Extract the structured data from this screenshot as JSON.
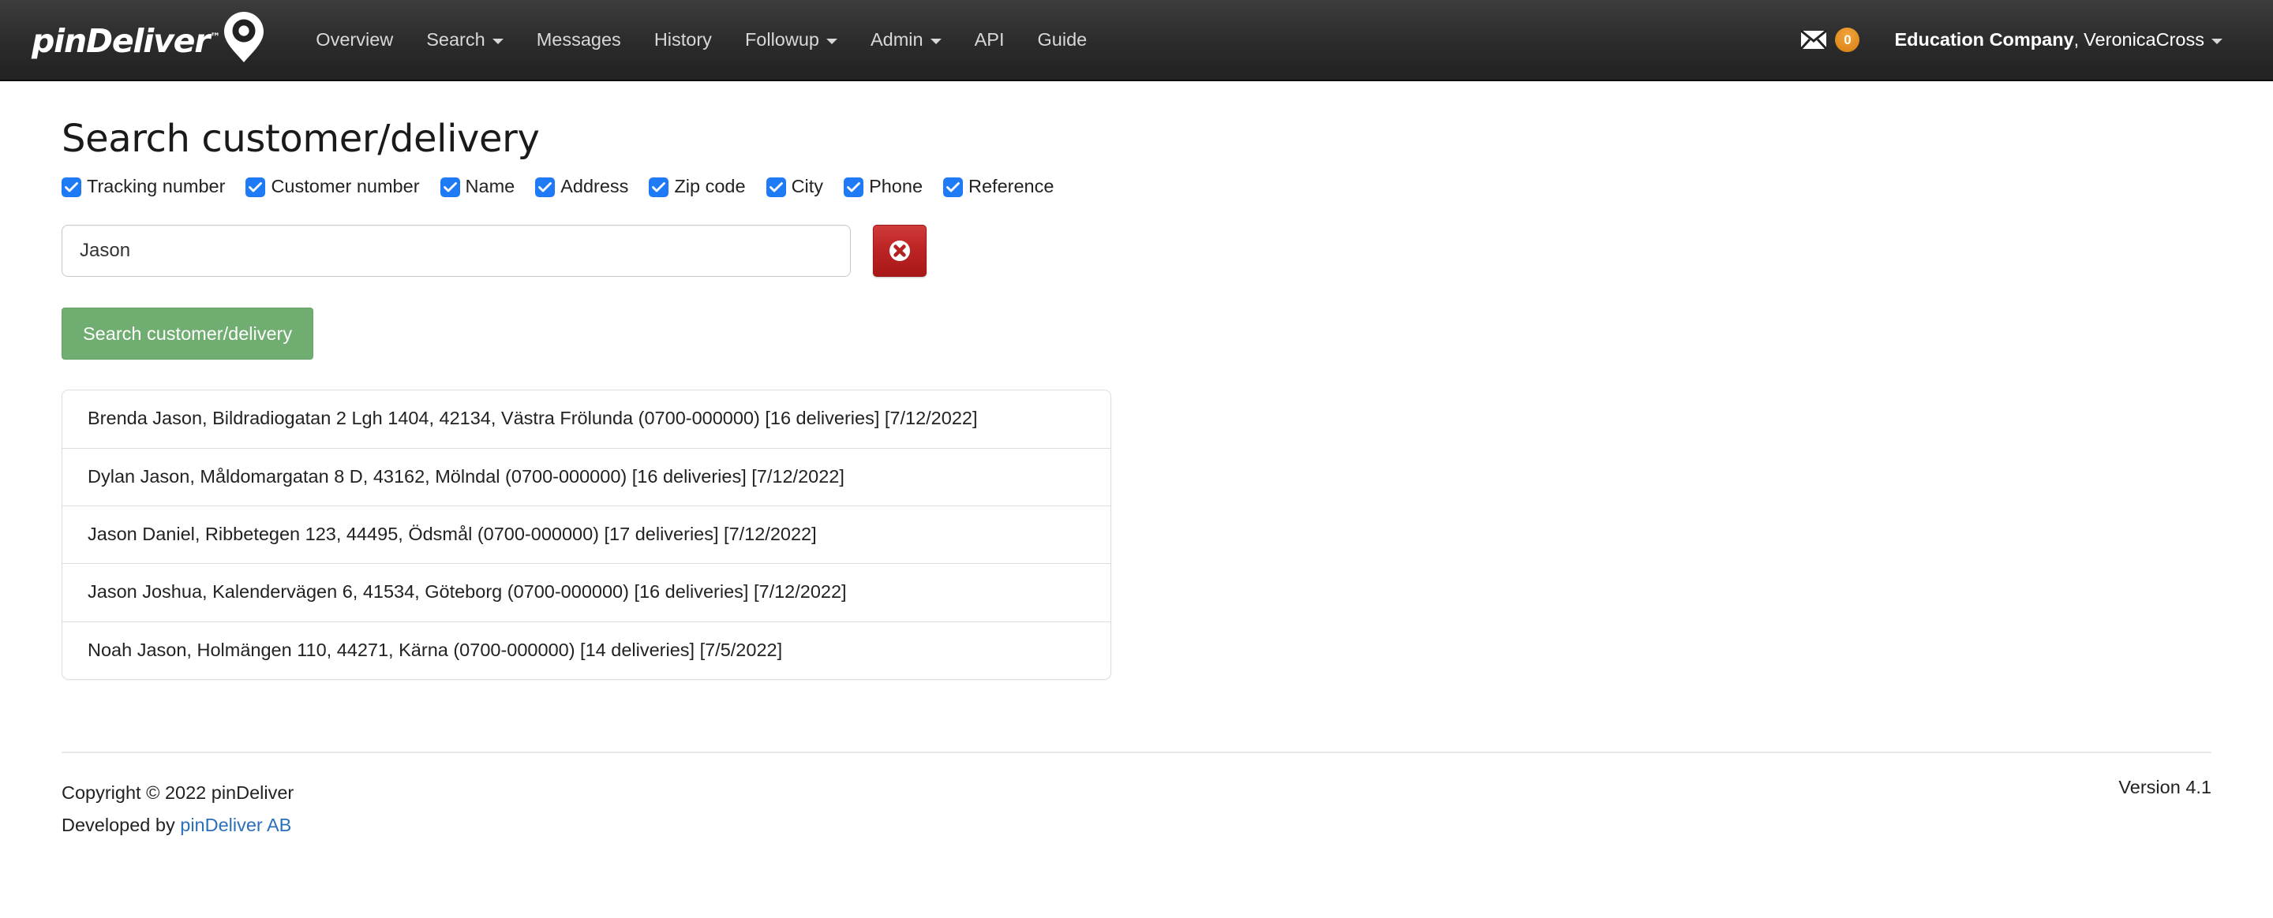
{
  "navbar": {
    "brand": {
      "wordmark": "pinDeliver",
      "trademark": "™",
      "pin_icon": "map-pin-icon"
    },
    "links": [
      {
        "label": "Overview",
        "has_caret": false
      },
      {
        "label": "Search",
        "has_caret": true
      },
      {
        "label": "Messages",
        "has_caret": false
      },
      {
        "label": "History",
        "has_caret": false
      },
      {
        "label": "Followup",
        "has_caret": true
      },
      {
        "label": "Admin",
        "has_caret": true
      },
      {
        "label": "API",
        "has_caret": false
      },
      {
        "label": "Guide",
        "has_caret": false
      }
    ],
    "messages": {
      "icon": "envelope-icon",
      "badge_count": "0",
      "badge_color": "#e08a1e"
    },
    "user": {
      "company": "Education Company",
      "separator": ",",
      "name": "VeronicaCross",
      "caret_icon": "chevron-down-icon"
    }
  },
  "main": {
    "title": "Search customer/delivery",
    "filters": [
      {
        "label": "Tracking number",
        "checked": true
      },
      {
        "label": "Customer number",
        "checked": true
      },
      {
        "label": "Name",
        "checked": true
      },
      {
        "label": "Address",
        "checked": true
      },
      {
        "label": "Zip code",
        "checked": true
      },
      {
        "label": "City",
        "checked": true
      },
      {
        "label": "Phone",
        "checked": true
      },
      {
        "label": "Reference",
        "checked": true
      }
    ],
    "search": {
      "value": "Jason",
      "placeholder": "",
      "clear_button_icon": "circle-x-icon",
      "clear_button_color": "#bd2525",
      "submit_label": "Search customer/delivery",
      "submit_color": "#70ad70"
    },
    "results": [
      "Brenda Jason, Bildradiogatan 2 Lgh 1404, 42134, Västra Frölunda (0700-000000) [16 deliveries] [7/12/2022]",
      "Dylan Jason, Måldomargatan 8 D, 43162, Mölndal (0700-000000) [16 deliveries] [7/12/2022]",
      "Jason Daniel, Ribbetegen 123, 44495, Ödsmål (0700-000000) [17 deliveries] [7/12/2022]",
      "Jason Joshua, Kalendervägen 6, 41534, Göteborg (0700-000000) [16 deliveries] [7/12/2022]",
      "Noah Jason, Holmängen 110, 44271, Kärna (0700-000000) [14 deliveries] [7/5/2022]"
    ]
  },
  "footer": {
    "copyright": "Copyright © 2022 pinDeliver",
    "developed_prefix": "Developed by ",
    "developed_link": "pinDeliver AB",
    "version": "Version 4.1"
  }
}
